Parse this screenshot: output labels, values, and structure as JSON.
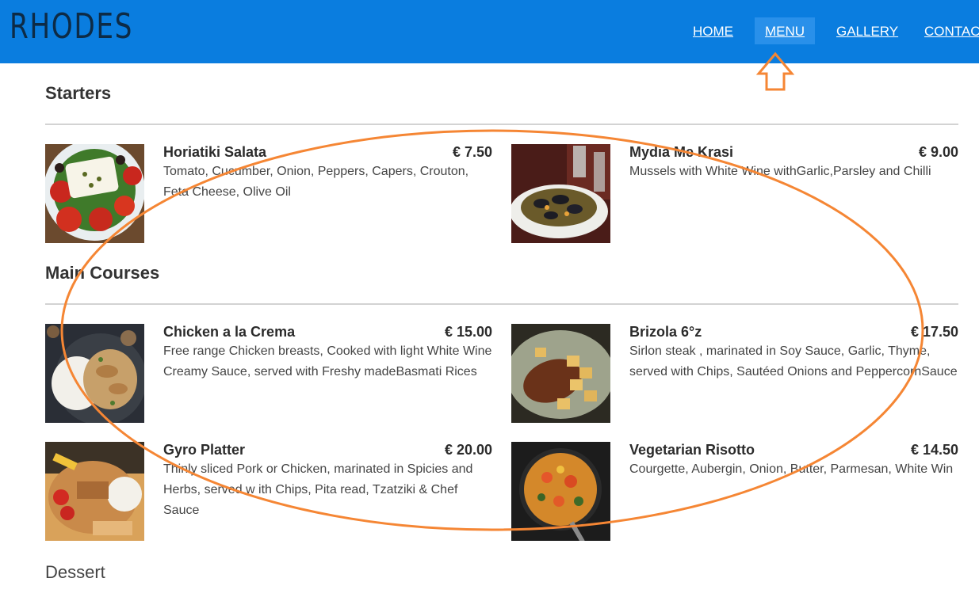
{
  "brand": {
    "logo": "RHODES"
  },
  "nav": {
    "items": [
      {
        "label": "HOME"
      },
      {
        "label": "MENU"
      },
      {
        "label": "GALLERY"
      },
      {
        "label": "CONTAC"
      }
    ],
    "active": "MENU"
  },
  "menu": {
    "sections": [
      {
        "title": "Starters"
      },
      {
        "title": "Main Courses"
      },
      {
        "title": "Dessert"
      }
    ],
    "dishes": [
      {
        "name": "Horiatiki Salata",
        "price": "€ 7.50",
        "description": "Tomato, Cucumber, Onion, Peppers, Capers, Crouton,\nFeta Cheese, Olive Oil"
      },
      {
        "name": "Mydia Me Krasi",
        "price": "€ 9.00",
        "description": "Mussels with White Wine withGarlic,Parsley and Chilli"
      },
      {
        "name": "Chicken a la Crema",
        "price": "€ 15.00",
        "description": "Free range Chicken breasts, Cooked with light White Wine\nCreamy Sauce, served with Freshy madeBasmati Rices"
      },
      {
        "name": "Brizola 6°z",
        "price": "€ 17.50",
        "description": "Sirlon steak , marinated in Soy Sauce, Garlic, Thyme,\nserved with Chips, Sautéed Onions and PeppercornSauce"
      },
      {
        "name": "Gyro Platter",
        "price": "€ 20.00",
        "description": "Thinly sliced Pork or Chicken, marinated in Spicies and\nHerbs, served w ith Chips, Pita read, Tzatziki & Chef\nSauce"
      },
      {
        "name": "Vegetarian Risotto",
        "price": "€ 14.50",
        "description": "Courgette, Aubergin, Onion, Butter, Parmesan, White Win"
      }
    ]
  },
  "annotation": {
    "color": "#f58634",
    "icons": [
      "up-arrow-icon",
      "ellipse-highlight"
    ]
  }
}
